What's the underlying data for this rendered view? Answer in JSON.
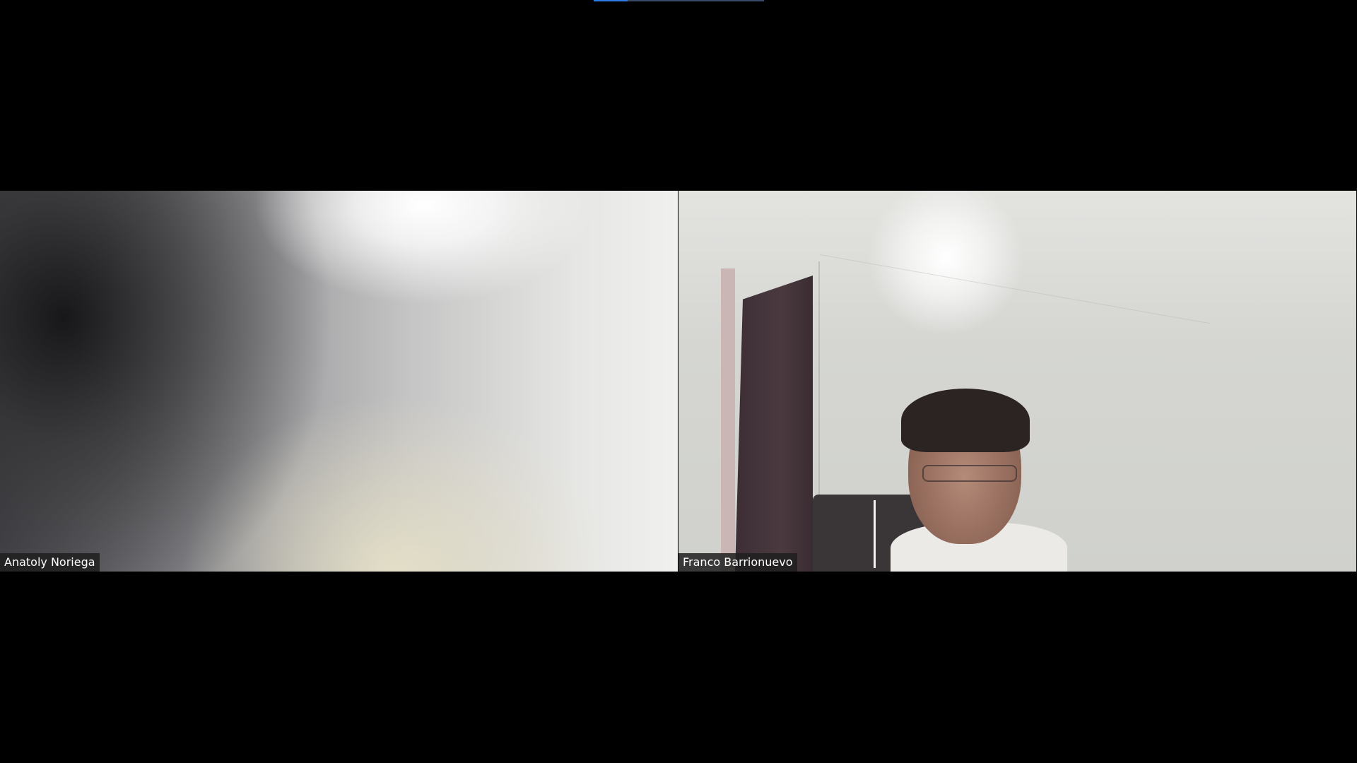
{
  "meeting": {
    "participants": [
      {
        "name": "Anatoly Noriega"
      },
      {
        "name": "Franco Barrionuevo"
      }
    ]
  },
  "colors": {
    "background": "#000000",
    "active_indicator": "#2d7be5",
    "name_label_background": "#1e1e1e"
  }
}
